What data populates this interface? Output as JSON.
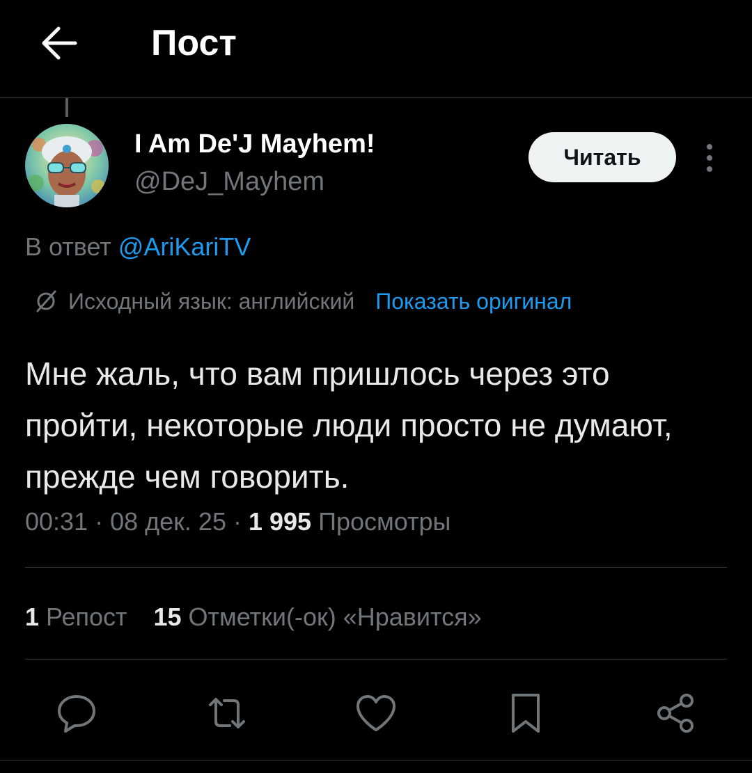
{
  "header": {
    "title": "Пост",
    "back_icon": "arrow-left-icon"
  },
  "author": {
    "display_name": "I Am De'J Mayhem!",
    "handle": "@DeJ_Mayhem",
    "follow_label": "Читать",
    "more_icon": "more-vertical-icon"
  },
  "reply": {
    "prefix": "В ответ ",
    "mention": "@AriKariTV"
  },
  "translation": {
    "icon": "translate-icon",
    "source_language": "Исходный язык: английский",
    "show_original": "Показать оригинал"
  },
  "post": {
    "text": "Мне жаль, что вам пришлось через это пройти, некоторые люди просто не думают, прежде чем говорить."
  },
  "meta": {
    "time": "00:31",
    "sep1": " · ",
    "date": "08 дек. 25",
    "sep2": " · ",
    "views_count": "1 995",
    "views_label": " Просмотры"
  },
  "stats": {
    "reposts_count": "1",
    "reposts_label": " Репост",
    "likes_count": "15",
    "likes_label": " Отметки(-ок) «Нравится»"
  },
  "actions": [
    {
      "name": "reply",
      "icon": "comment-icon"
    },
    {
      "name": "repost",
      "icon": "retweet-icon"
    },
    {
      "name": "like",
      "icon": "heart-icon"
    },
    {
      "name": "bookmark",
      "icon": "bookmark-icon"
    },
    {
      "name": "share",
      "icon": "share-icon"
    }
  ],
  "colors": {
    "background": "#000000",
    "text_primary": "#e7e9ea",
    "text_secondary": "#71767b",
    "accent": "#1d9bf0",
    "divider": "#2f3336"
  }
}
